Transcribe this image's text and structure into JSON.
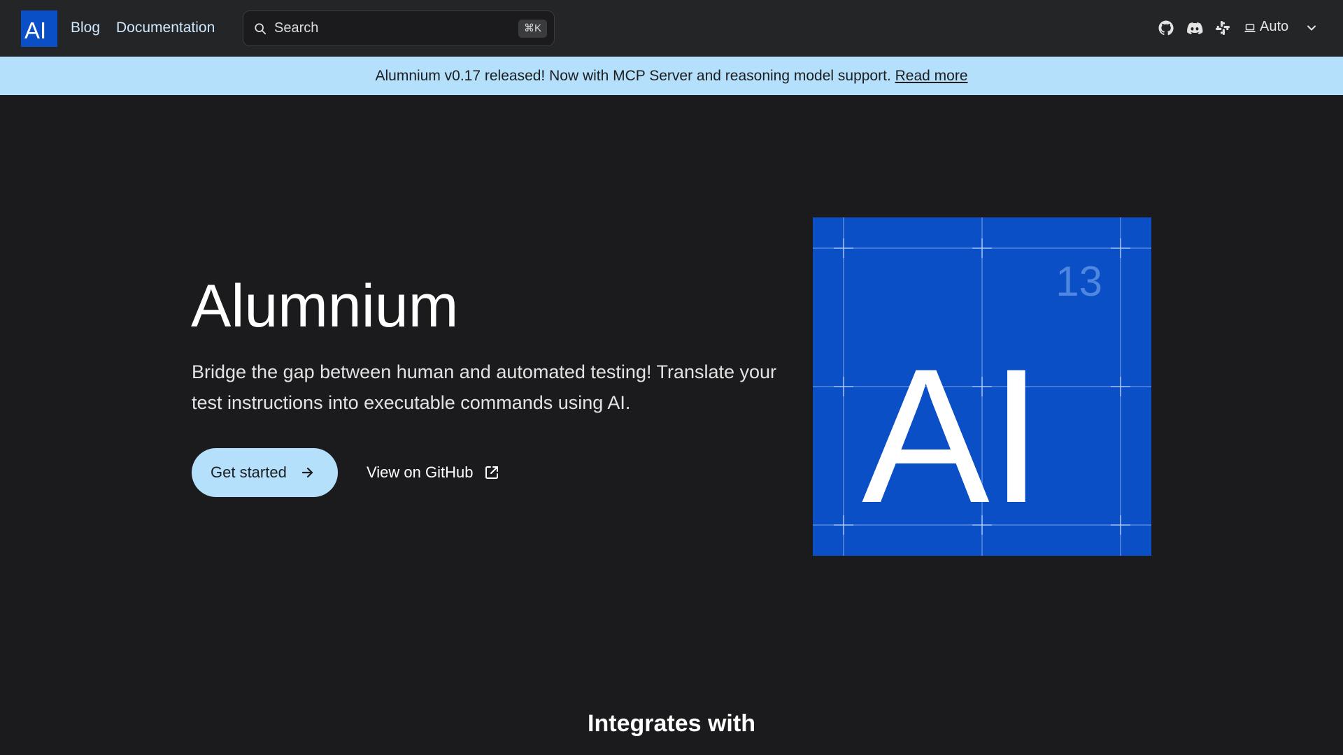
{
  "navbar": {
    "logo_text": "AI",
    "links": [
      "Blog",
      "Documentation"
    ],
    "search": {
      "placeholder": "Search",
      "shortcut": "⌘K"
    },
    "icons": [
      "github-icon",
      "discord-icon",
      "slack-icon"
    ],
    "theme": {
      "label": "Auto"
    }
  },
  "announcement": {
    "text": "Alumnium v0.17 released! Now with MCP Server and reasoning model support.",
    "link": "Read more"
  },
  "hero": {
    "title": "Alumnium",
    "subtitle": "Bridge the gap between human and automated testing! Translate your test instructions into executable commands using AI.",
    "primary_button": "Get started",
    "secondary_button": "View on GitHub"
  },
  "tile": {
    "atomic_number": "13",
    "symbol": "AI"
  },
  "section": {
    "integrates_title": "Integrates with"
  },
  "colors": {
    "brand_blue": "#0a4fc6",
    "accent_light_blue": "#b5e0fb",
    "background": "#1b1b1d",
    "navbar": "#242526"
  }
}
